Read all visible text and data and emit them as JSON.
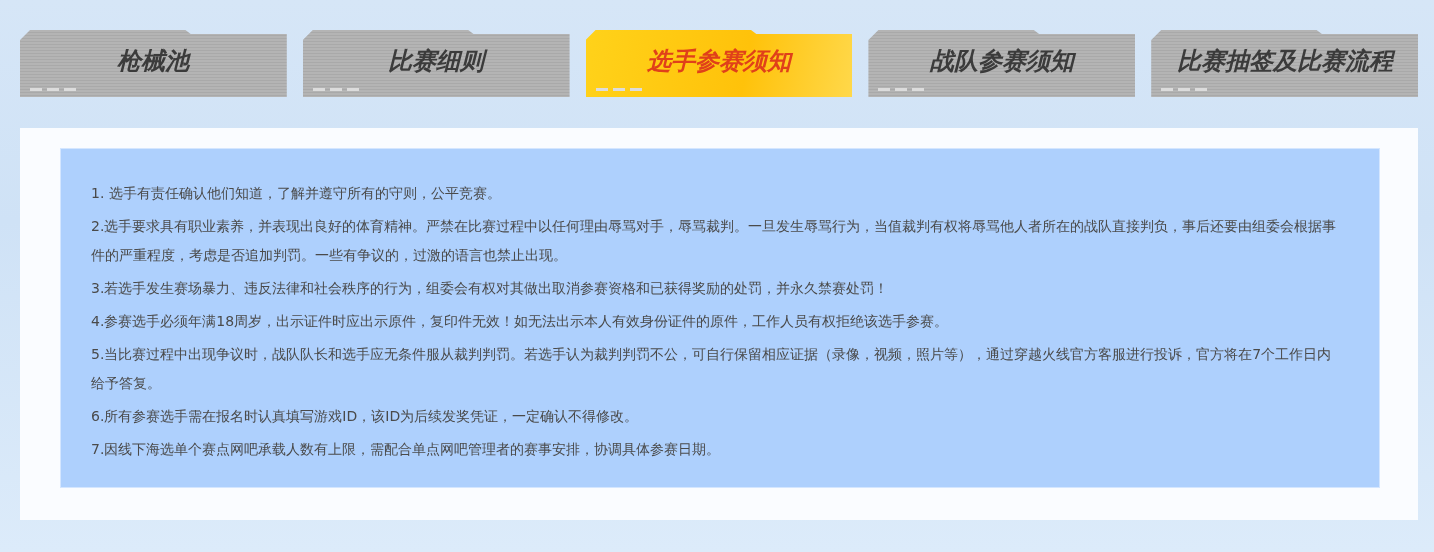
{
  "tabs": [
    {
      "label": "枪械池",
      "selected": false
    },
    {
      "label": "比赛细则",
      "selected": false
    },
    {
      "label": "选手参赛须知",
      "selected": true
    },
    {
      "label": "战队参赛须知",
      "selected": false
    },
    {
      "label": "比赛抽签及比赛流程",
      "selected": false
    }
  ],
  "rules": [
    "1. 选手有责任确认他们知道，了解并遵守所有的守则，公平竞赛。",
    "2.选手要求具有职业素养，并表现出良好的体育精神。严禁在比赛过程中以任何理由辱骂对手，辱骂裁判。一旦发生辱骂行为，当值裁判有权将辱骂他人者所在的战队直接判负，事后还要由组委会根据事件的严重程度，考虑是否追加判罚。一些有争议的，过激的语言也禁止出现。",
    "3.若选手发生赛场暴力、违反法律和社会秩序的行为，组委会有权对其做出取消参赛资格和已获得奖励的处罚，并永久禁赛处罚！",
    "4.参赛选手必须年满18周岁，出示证件时应出示原件，复印件无效！如无法出示本人有效身份证件的原件，工作人员有权拒绝该选手参赛。",
    "5.当比赛过程中出现争议时，战队队长和选手应无条件服从裁判判罚。若选手认为裁判判罚不公，可自行保留相应证据（录像，视频，照片等），通过穿越火线官方客服进行投诉，官方将在7个工作日内给予答复。",
    "6.所有参赛选手需在报名时认真填写游戏ID，该ID为后续发奖凭证，一定确认不得修改。",
    "7.因线下海选单个赛点网吧承载人数有上限，需配合单点网吧管理者的赛事安排，协调具体参赛日期。"
  ]
}
